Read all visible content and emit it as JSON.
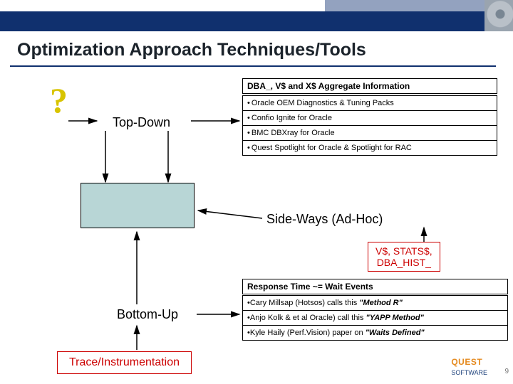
{
  "title": "Optimization Approach Techniques/Tools",
  "qmark": "?",
  "topdown": "Top-Down",
  "dba_header": "DBA_, V$ and X$ Aggregate Information",
  "dba_items": {
    "i0": "Oracle OEM Diagnostics & Tuning Packs",
    "i1": "Confio Ignite for Oracle",
    "i2": "BMC DBXray for Oracle",
    "i3": "Quest Spotlight for Oracle & Spotlight for RAC"
  },
  "sideways": "Side-Ways (Ad-Hoc)",
  "statsbox_l1": "V$, STATS$,",
  "statsbox_l2": "DBA_HIST_",
  "rt_header": "Response Time ~= Wait Events",
  "rt_items": {
    "r0_a": "Cary Millsap (Hotsos) calls this ",
    "r0_b": "\"Method R\"",
    "r1_a": "Anjo Kolk & et al Oracle) call this ",
    "r1_b": "\"YAPP Method\"",
    "r2_a": "Kyle Haily (Perf.Vision) paper on ",
    "r2_b": "\"Waits Defined\""
  },
  "bottomup": "Bottom-Up",
  "trace": "Trace/Instrumentation",
  "logo_brand": "QUEST",
  "logo_sub": "SOFTWARE",
  "pagenum": "9"
}
